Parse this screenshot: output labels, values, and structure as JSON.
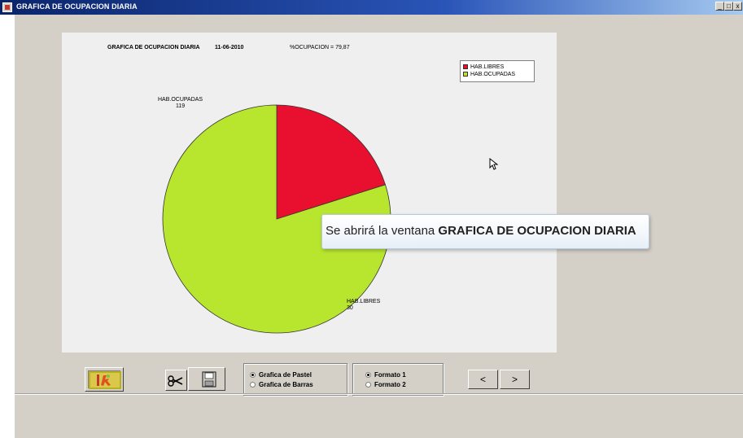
{
  "window": {
    "title": "GRAFICA DE OCUPACION DIARIA",
    "controls": [
      "_",
      "□",
      "x"
    ]
  },
  "chart_header": {
    "title": "GRAFICA DE OCUPACION DIARIA",
    "date": "11-06-2010",
    "occupancy_text": "%OCUPACION = 79,87"
  },
  "legend": {
    "items": [
      {
        "label": "HAB.LIBRES",
        "color": "#e8102e"
      },
      {
        "label": "HAB.OCUPADAS",
        "color": "#b8e62f"
      }
    ]
  },
  "chart_data": {
    "type": "pie",
    "title": "GRAFICA DE OCUPACION DIARIA",
    "categories": [
      "HAB.LIBRES",
      "HAB.OCUPADAS"
    ],
    "values": [
      30,
      119
    ],
    "colors": [
      "#e8102e",
      "#b8e62f"
    ],
    "legend_position": "top-right"
  },
  "slice_labels": {
    "ocupadas_name": "HAB.OCUPADAS",
    "ocupadas_value": "119",
    "libres_name": "HAB.LIBRES",
    "libres_value": "30"
  },
  "tooltip": {
    "prefix": "Se abrirá la ventana ",
    "bold": "GRAFICA DE OCUPACION DIARIA"
  },
  "chart_type_group": {
    "options": [
      "Grafica de Pastel",
      "Grafica de Barras"
    ],
    "selected": 0
  },
  "format_group": {
    "options": [
      "Formato 1",
      "Formato 2"
    ],
    "selected": 0
  },
  "nav": {
    "prev_label": "<",
    "next_label": ">"
  },
  "icons": {
    "exit": "exit-icon",
    "cut": "scissors-icon",
    "save": "floppy-disk-icon"
  }
}
